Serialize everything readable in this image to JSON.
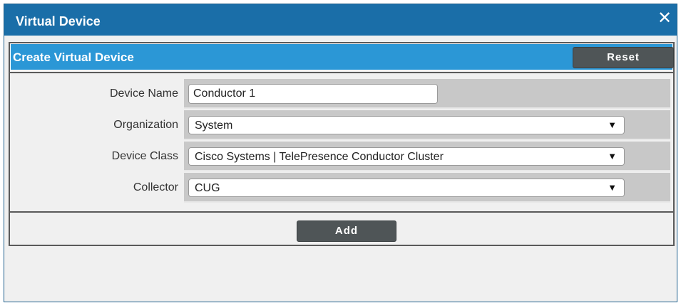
{
  "window": {
    "title": "Virtual Device",
    "close_glyph": "✕"
  },
  "panel": {
    "title": "Create Virtual Device",
    "reset_label": "Reset",
    "add_label": "Add"
  },
  "form": {
    "device_name": {
      "label": "Device Name",
      "value": "Conductor 1"
    },
    "organization": {
      "label": "Organization",
      "value": "System"
    },
    "device_class": {
      "label": "Device Class",
      "value": "Cisco Systems | TelePresence Conductor Cluster"
    },
    "collector": {
      "label": "Collector",
      "value": "CUG"
    }
  },
  "icons": {
    "dropdown": "chevron-down-icon",
    "close": "close-icon"
  },
  "colors": {
    "titlebar": "#1a6ea8",
    "panel_header": "#2b97d6",
    "button": "#4f5557"
  }
}
